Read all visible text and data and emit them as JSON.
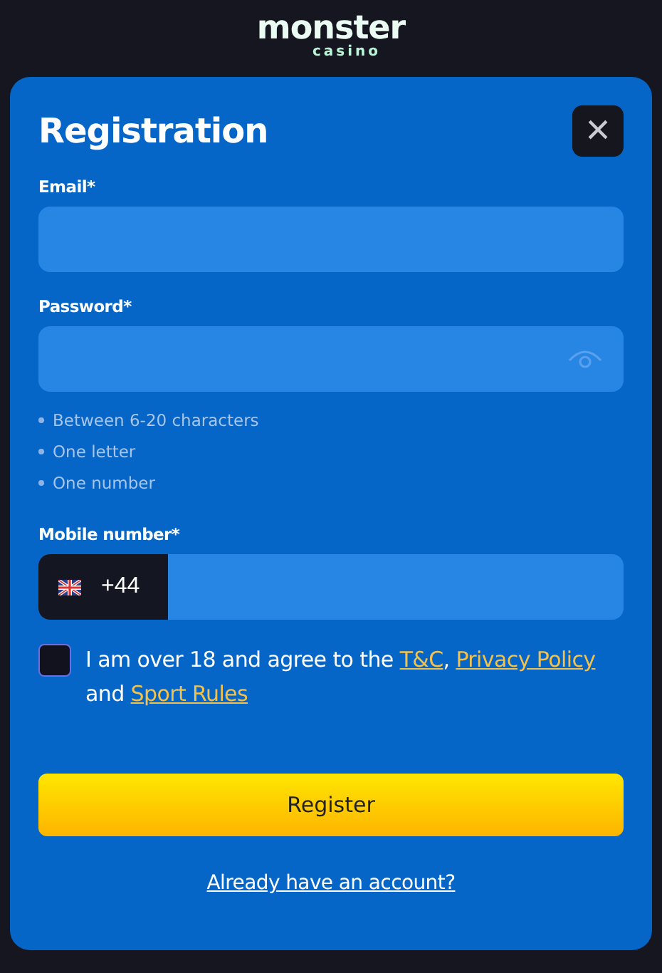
{
  "logo": {
    "name": "monster",
    "tagline": "casino"
  },
  "dialog": {
    "title": "Registration",
    "close": "×"
  },
  "fields": [
    {
      "kind": "email",
      "label": "Email*"
    },
    {
      "kind": "password",
      "label": "Password*",
      "hints": [
        "Between 6-20 characters",
        "One letter",
        "One number"
      ]
    },
    {
      "kind": "phone",
      "label": "Mobile number*",
      "code": "+44"
    }
  ],
  "agreement": {
    "checked": false,
    "parts": [
      {
        "kind": "text",
        "text": "I am over 18 and agree to the "
      },
      {
        "kind": "link",
        "text": "T&C"
      },
      {
        "kind": "text",
        "text": ", "
      },
      {
        "kind": "link",
        "text": "Privacy Policy"
      },
      {
        "kind": "text",
        "text": " and "
      },
      {
        "kind": "link",
        "text": "Sport Rules"
      }
    ]
  },
  "submit": "Register",
  "login_link": "Already have an account?"
}
